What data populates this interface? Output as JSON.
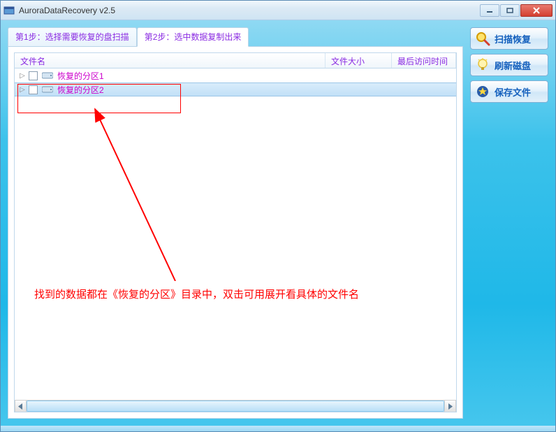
{
  "window": {
    "title": "AuroraDataRecovery v2.5"
  },
  "tabs": [
    {
      "label": "第1步：选择需要恢复的盘扫描",
      "active": false
    },
    {
      "label": "第2步：选中数据复制出来",
      "active": true
    }
  ],
  "columns": {
    "name": "文件名",
    "size": "文件大小",
    "time": "最后访问时间"
  },
  "rows": [
    {
      "label": "恢复的分区1",
      "selected": false
    },
    {
      "label": "恢复的分区2",
      "selected": true
    }
  ],
  "annotation": {
    "text": "找到的数据都在《恢复的分区》目录中，双击可用展开看具体的文件名"
  },
  "actions": {
    "scan": "扫描恢复",
    "refresh": "刷新磁盘",
    "save": "保存文件"
  }
}
